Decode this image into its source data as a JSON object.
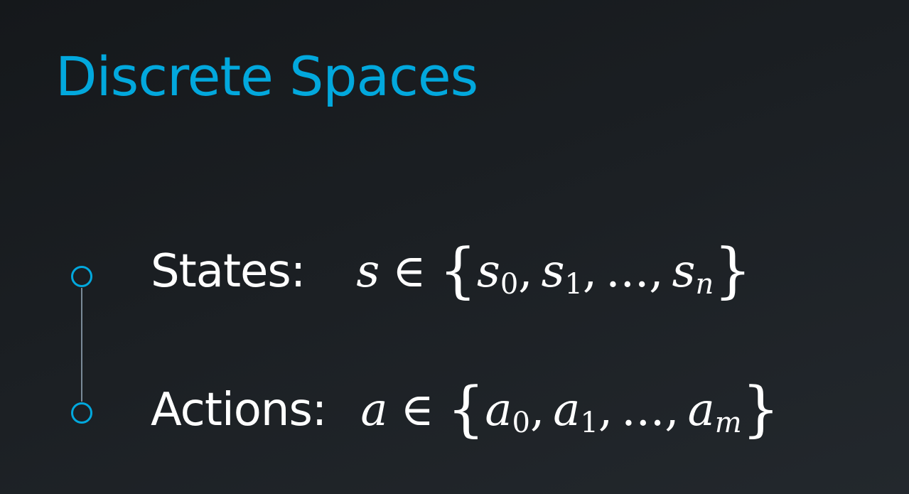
{
  "slide": {
    "title": "Discrete Spaces",
    "accent_color": "#02a8dd",
    "items": [
      {
        "label": "States:",
        "formula": {
          "var": "s",
          "op": "∈",
          "open": "{",
          "close": "}",
          "elements": [
            {
              "base": "s",
              "sub": "0"
            },
            {
              "base": "s",
              "sub": "1"
            },
            {
              "base": "...",
              "sub": ""
            },
            {
              "base": "s",
              "sub": "n"
            }
          ],
          "separator": ","
        }
      },
      {
        "label": "Actions:",
        "formula": {
          "var": "a",
          "op": "∈",
          "open": "{",
          "close": "}",
          "elements": [
            {
              "base": "a",
              "sub": "0"
            },
            {
              "base": "a",
              "sub": "1"
            },
            {
              "base": "...",
              "sub": ""
            },
            {
              "base": "a",
              "sub": "m"
            }
          ],
          "separator": ","
        }
      }
    ]
  }
}
